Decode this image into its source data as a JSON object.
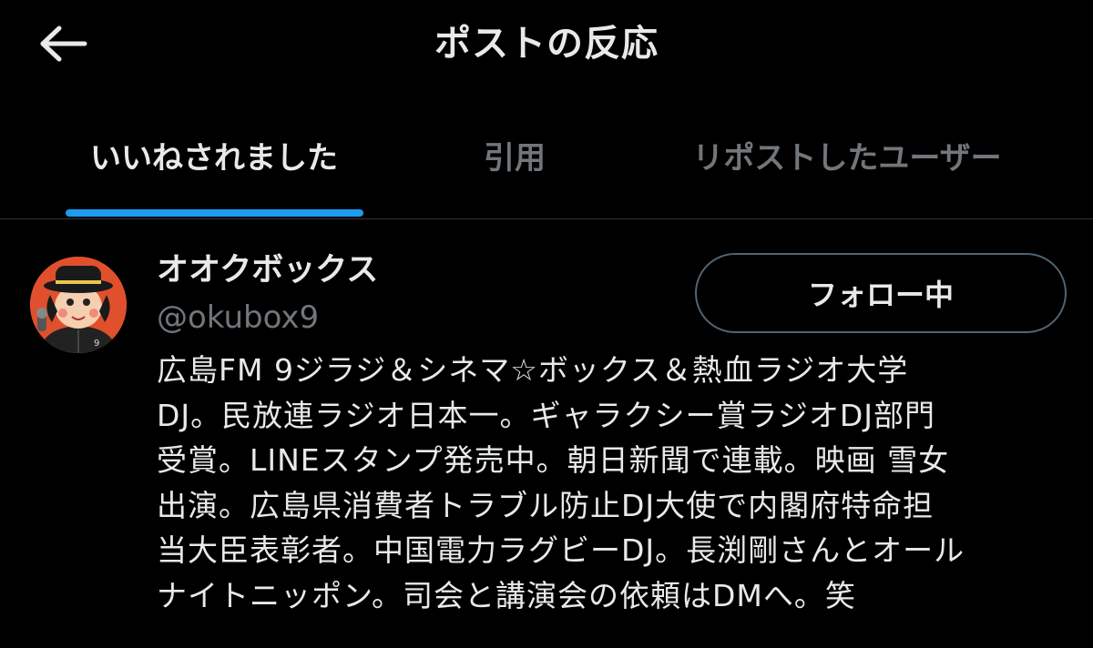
{
  "header": {
    "title": "ポストの反応",
    "back_icon": "arrow-left-icon"
  },
  "tabs": [
    {
      "label": "いいねされました",
      "active": true
    },
    {
      "label": "引用",
      "active": false
    },
    {
      "label": "リポストしたユーザー",
      "active": false
    }
  ],
  "colors": {
    "background": "#000000",
    "text_primary": "#e7e9ea",
    "text_secondary": "#71767b",
    "accent": "#1d9bf0",
    "avatar_bg": "#e0502d"
  },
  "user": {
    "display_name": "オオクボックス",
    "handle": "@okubox9",
    "follow_button_label": "フォロー中",
    "bio_lines": [
      "広島FM 9ジラジ＆シネマ☆ボックス＆熱血ラジオ大学",
      "DJ。民放連ラジオ日本一。ギャラクシー賞ラジオDJ部門",
      "受賞。LINEスタンプ発売中。朝日新聞で連載。映画 雪女",
      "出演。広島県消費者トラブル防止DJ大使で内閣府特命担",
      "当大臣表彰者。中国電力ラグビーDJ。長渕剛さんとオール",
      "ナイトニッポン。司会と講演会の依頼はDMへ。笑"
    ]
  }
}
